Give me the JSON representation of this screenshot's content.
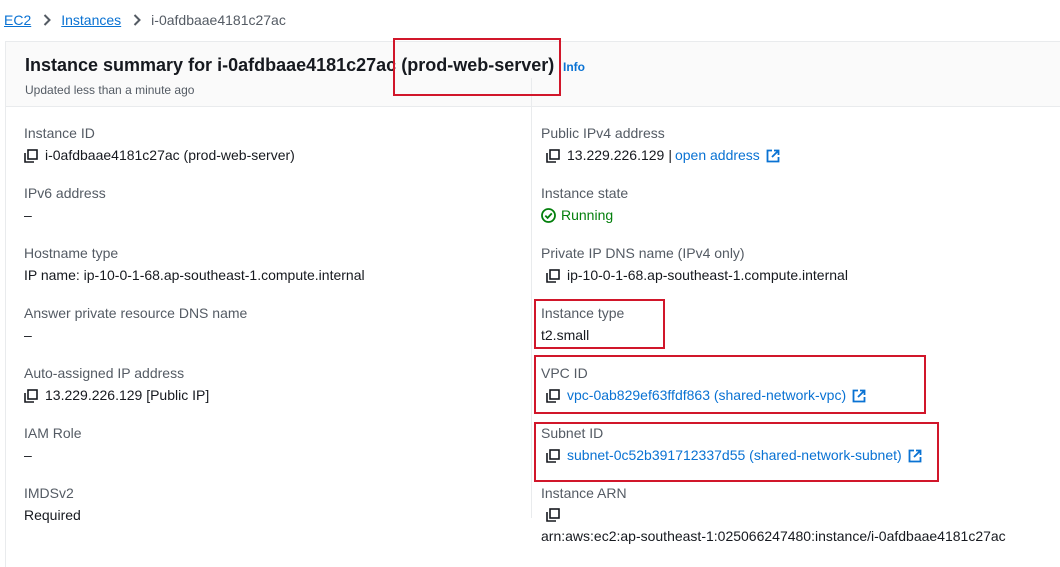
{
  "breadcrumb": {
    "items": [
      {
        "label": "EC2"
      },
      {
        "label": "Instances"
      },
      {
        "label": "i-0afdbaae4181c27ac"
      }
    ]
  },
  "summary": {
    "title_prefix": "Instance summary for i-0afdbaae4181c27ac",
    "title_name": "(prod-web-server)",
    "info_label": "Info",
    "updated": "Updated less than a minute ago"
  },
  "left": {
    "instance_id": {
      "label": "Instance ID",
      "value": "i-0afdbaae4181c27ac (prod-web-server)"
    },
    "ipv6": {
      "label": "IPv6 address",
      "value": "–"
    },
    "hostname_type": {
      "label": "Hostname type",
      "value": "IP name: ip-10-0-1-68.ap-southeast-1.compute.internal"
    },
    "answer_dns": {
      "label": "Answer private resource DNS name",
      "value": "–"
    },
    "auto_ip": {
      "label": "Auto-assigned IP address",
      "value": "13.229.226.129 [Public IP]"
    },
    "iam_role": {
      "label": "IAM Role",
      "value": "–"
    },
    "imdsv2": {
      "label": "IMDSv2",
      "value": "Required"
    }
  },
  "right": {
    "public_ipv4": {
      "label": "Public IPv4 address",
      "value": "13.229.226.129",
      "link": "open address"
    },
    "state": {
      "label": "Instance state",
      "value": "Running"
    },
    "private_dns": {
      "label": "Private IP DNS name (IPv4 only)",
      "value": "ip-10-0-1-68.ap-southeast-1.compute.internal"
    },
    "instance_type": {
      "label": "Instance type",
      "value": "t2.small"
    },
    "vpc": {
      "label": "VPC ID",
      "value": "vpc-0ab829ef63ffdf863 (shared-network-vpc)"
    },
    "subnet": {
      "label": "Subnet ID",
      "value": "subnet-0c52b391712337d55 (shared-network-subnet)"
    },
    "arn": {
      "label": "Instance ARN",
      "value": "arn:aws:ec2:ap-southeast-1:025066247480:instance/i-0afdbaae4181c27ac"
    }
  },
  "colors": {
    "link": "#0972d3",
    "running": "#037f0c",
    "highlight": "#d1162a"
  }
}
